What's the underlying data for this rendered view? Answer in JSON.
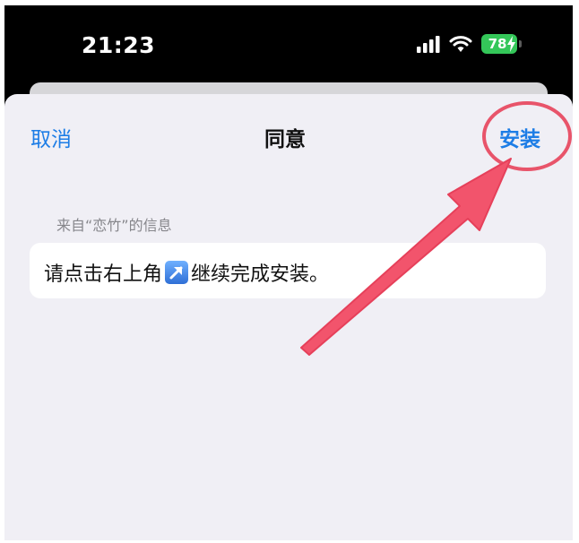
{
  "status_bar": {
    "time": "21:23",
    "battery": "78",
    "icons": [
      "signal-icon",
      "wifi-icon",
      "battery-icon",
      "charging-bolt-icon"
    ]
  },
  "nav": {
    "cancel_label": "取消",
    "title": "同意",
    "install_label": "安装"
  },
  "section": {
    "header": "来自“恋竹”的信息"
  },
  "message": {
    "before_icon": "请点击右上角",
    "icon": "arrow-up-right-icon",
    "after_icon": "继续完成安装。"
  },
  "annotations": {
    "highlight_color": "#e8546a",
    "items": [
      "highlight-circle",
      "pointer-arrow"
    ]
  },
  "colors": {
    "accent": "#1d7de6",
    "sheet_bg": "#f0eff5",
    "battery": "#34c759"
  }
}
